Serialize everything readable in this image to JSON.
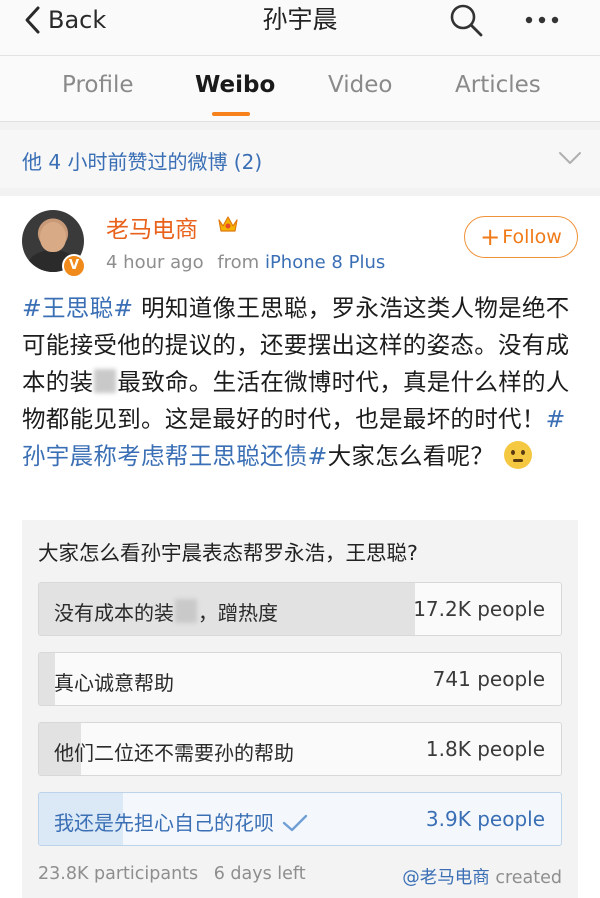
{
  "nav": {
    "back_label": "Back",
    "title": "孙宇晨"
  },
  "tabs": [
    {
      "label": "Profile",
      "active": false
    },
    {
      "label": "Weibo",
      "active": true
    },
    {
      "label": "Video",
      "active": false
    },
    {
      "label": "Articles",
      "active": false
    }
  ],
  "liked_banner": {
    "text": "他 4 小时前赞过的微博 (2)"
  },
  "post": {
    "username": "老马电商",
    "time": "4 hour ago",
    "from_label": "from",
    "device": "iPhone 8 Plus",
    "follow_label": "Follow",
    "text": {
      "tag1": "#王思聪#",
      "part1": " 明知道像王思聪，罗永浩这类人物是绝不可能接受他的提议的，还要摆出这样的姿态。没有成本的装",
      "part2": "最致命。生活在微博时代，真是什么样的人物都能见到。这是最好的时代，也是最坏的时代！",
      "tag2": "#孙宇晨称考虑帮王思聪还债#",
      "part3": "大家怎么看呢？"
    }
  },
  "poll": {
    "question": "大家怎么看孙宇晨表态帮罗永浩，王思聪?",
    "options": [
      {
        "label_a": "没有成本的装",
        "label_b": "，蹭热度",
        "count": "17.2K people",
        "share": 0.72,
        "selected": false
      },
      {
        "label": "真心诚意帮助",
        "count": "741 people",
        "share": 0.03,
        "selected": false
      },
      {
        "label": "他们二位还不需要孙的帮助",
        "count": "1.8K people",
        "share": 0.08,
        "selected": false
      },
      {
        "label": "我还是先担心自己的花呗",
        "count": "3.9K people",
        "share": 0.16,
        "selected": true
      }
    ],
    "participants": "23.8K participants",
    "days_left": "6 days left",
    "creator": "@老马电商",
    "created_label": "created"
  },
  "colors": {
    "accent_orange": "#f7821b",
    "link_blue": "#3a6fb5",
    "username_orange": "#e8621c"
  },
  "icons": {
    "back": "chevron-left-icon",
    "search": "search-icon",
    "more": "more-dots-icon",
    "liked_expand": "chevron-down-icon",
    "vip": "crown-icon",
    "verified": "verified-v-icon",
    "selected": "checkmark-icon",
    "emoji": "thinking-emoji-icon"
  }
}
